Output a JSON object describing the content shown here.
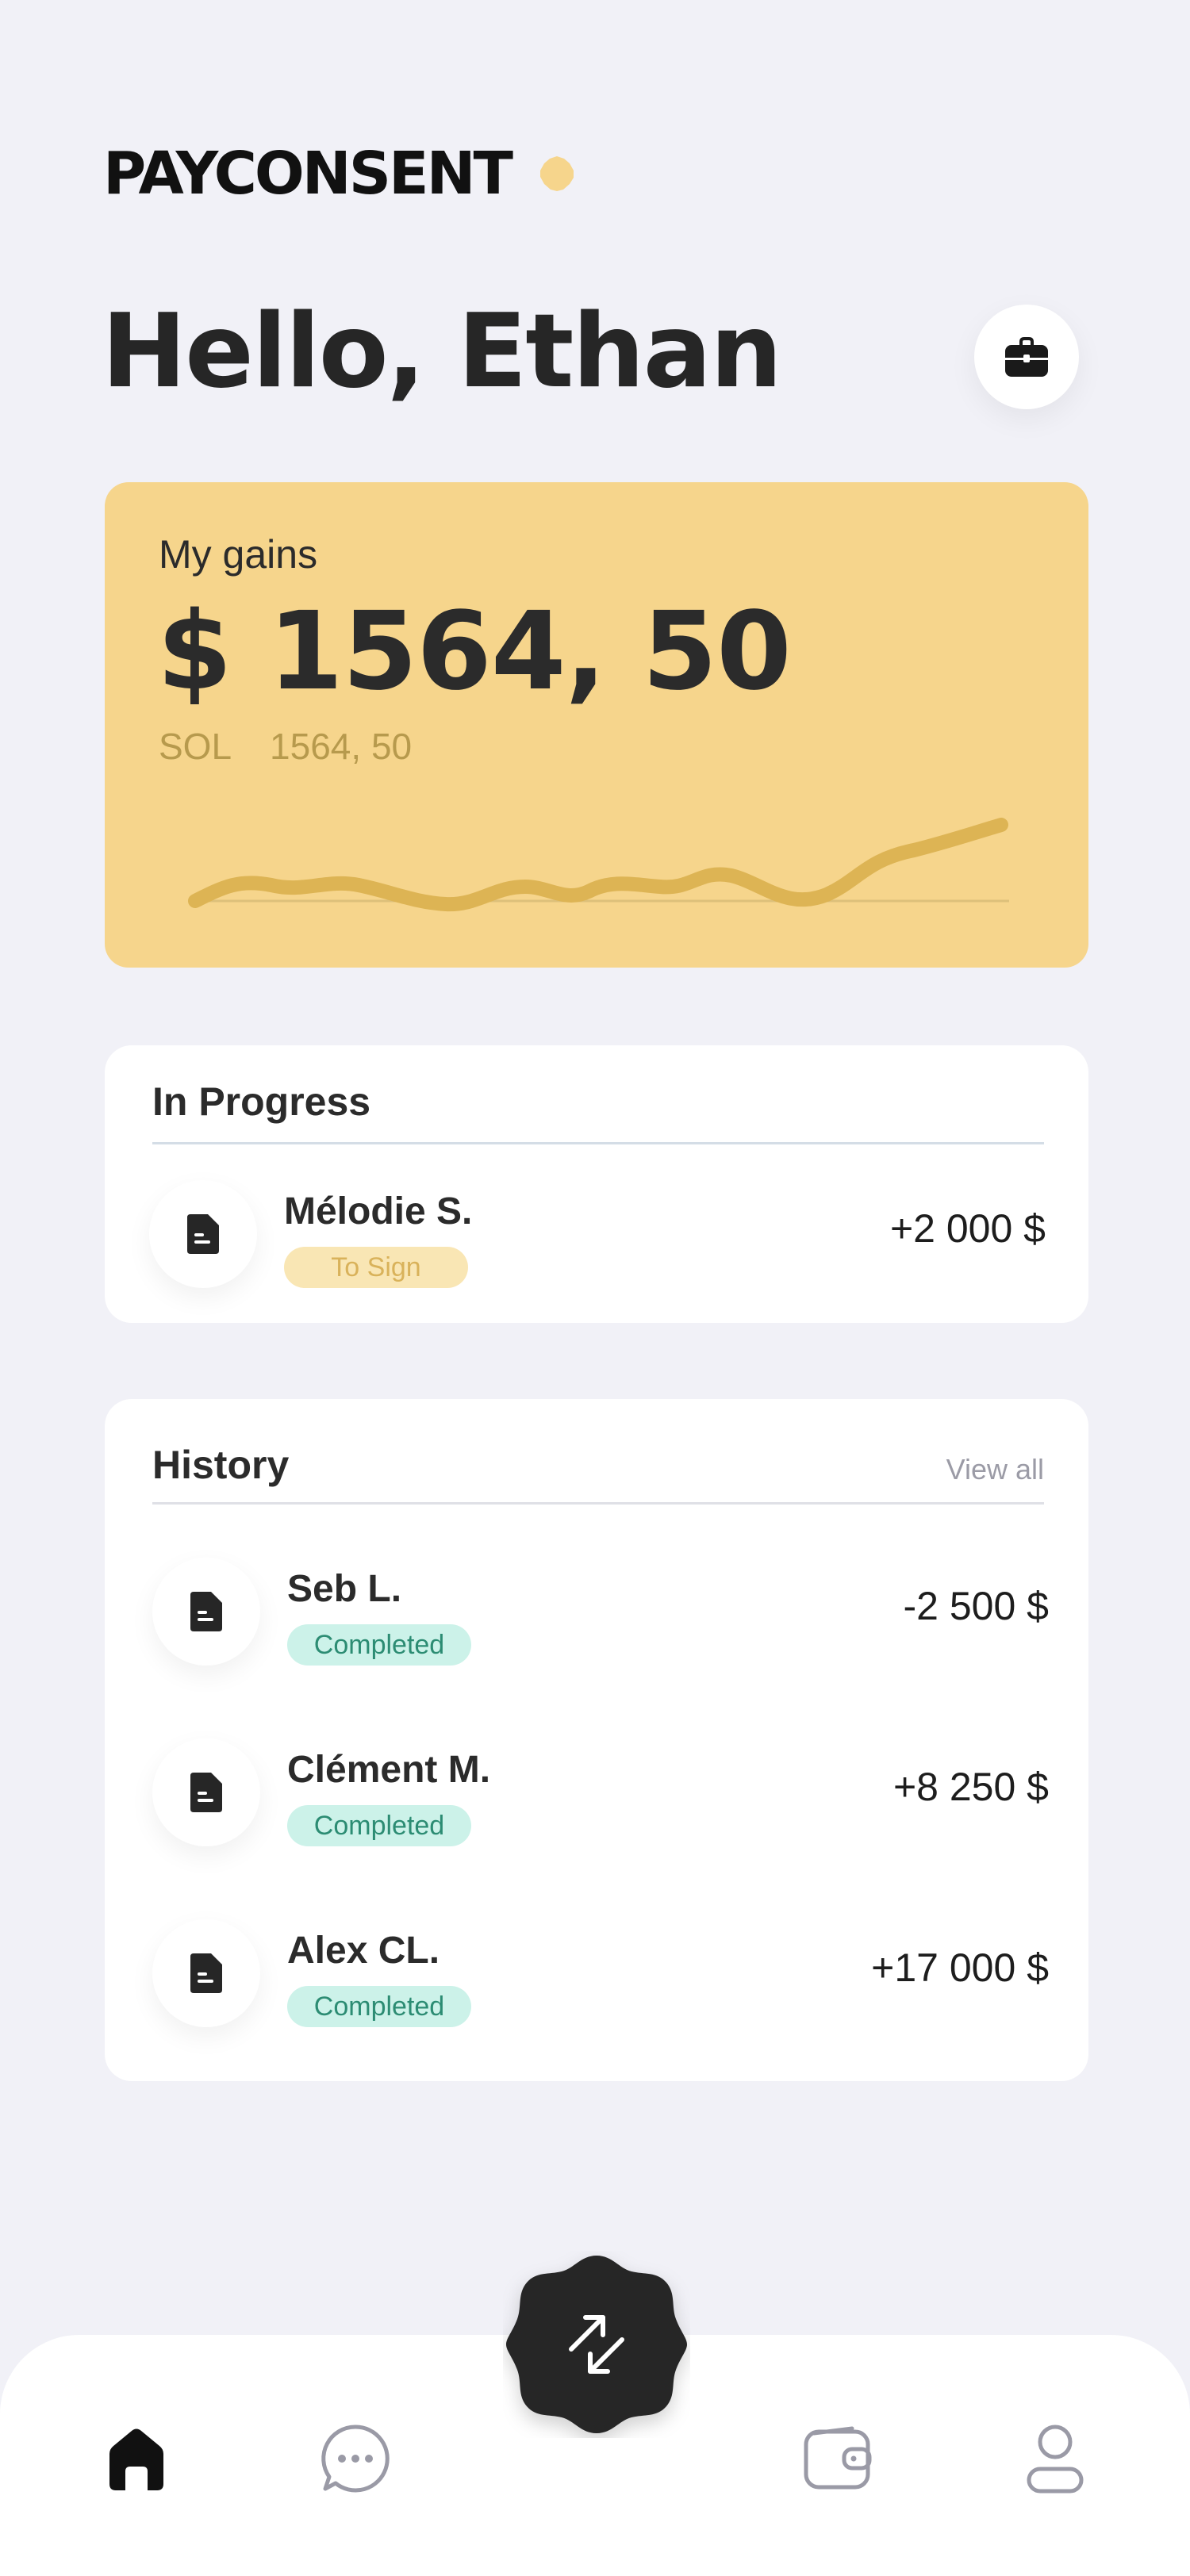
{
  "header": {
    "brand": "PAYCONSENT",
    "greeting": "Hello, Ethan"
  },
  "gains": {
    "label": "My gains",
    "amount": "$ 1564, 50",
    "currency": "SOL",
    "amount_sol": "1564, 50"
  },
  "in_progress": {
    "title": "In Progress",
    "items": [
      {
        "name": "Mélodie S.",
        "status": "To Sign",
        "amount": "+2 000 $"
      }
    ]
  },
  "history": {
    "title": "History",
    "view_all": "View all",
    "items": [
      {
        "name": "Seb L.",
        "status": "Completed",
        "amount": "-2 500 $"
      },
      {
        "name": "Clément M.",
        "status": "Completed",
        "amount": "+8 250 $"
      },
      {
        "name": "Alex CL.",
        "status": "Completed",
        "amount": "+17 000 $"
      }
    ]
  },
  "nav": {
    "items": [
      "home-icon",
      "chat-icon",
      "wallet-icon",
      "profile-icon"
    ],
    "fab_icon": "transfer-arrows-icon"
  },
  "colors": {
    "background": "#f1f1f7",
    "gains_card": "#f6d58c",
    "gains_line": "#ddb454",
    "accent_dot": "#f6d58c",
    "to_sign_badge": "#f9e6b4",
    "completed_badge": "#ccf2e9",
    "dark": "#262626"
  }
}
